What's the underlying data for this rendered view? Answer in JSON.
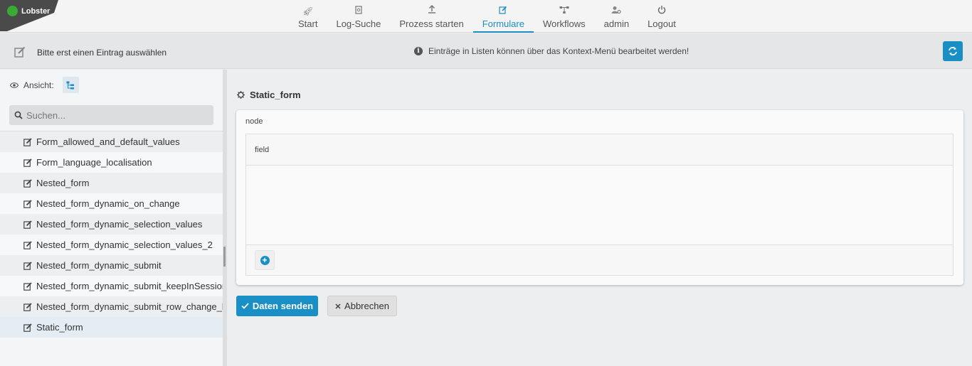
{
  "app": {
    "logo_text": "Lobster"
  },
  "nav": {
    "items": [
      {
        "label": "Start",
        "icon": "rocket-icon"
      },
      {
        "label": "Log-Suche",
        "icon": "file-search-icon"
      },
      {
        "label": "Prozess starten",
        "icon": "upload-icon"
      },
      {
        "label": "Formulare",
        "icon": "edit-icon",
        "active": true
      },
      {
        "label": "Workflows",
        "icon": "workflow-icon"
      },
      {
        "label": "admin",
        "icon": "user-gear-icon"
      },
      {
        "label": "Logout",
        "icon": "power-icon"
      }
    ]
  },
  "subbar": {
    "title": "Bitte erst einen Eintrag auswählen",
    "info": "Einträge in Listen können über das Kontext-Menü bearbeitet werden!"
  },
  "sidebar": {
    "view_label": "Ansicht:",
    "search_placeholder": "Suchen...",
    "items": [
      "Form_allowed_and_default_values",
      "Form_language_localisation",
      "Nested_form",
      "Nested_form_dynamic_on_change",
      "Nested_form_dynamic_selection_values",
      "Nested_form_dynamic_selection_values_2",
      "Nested_form_dynamic_submit",
      "Nested_form_dynamic_submit_keepInSession",
      "Nested_form_dynamic_submit_row_change_kind",
      "Static_form"
    ],
    "selected": "Static_form"
  },
  "main": {
    "form_title": "Static_form",
    "node_label": "node",
    "field_label": "field",
    "send_label": "Daten senden",
    "cancel_label": "Abbrechen"
  },
  "colors": {
    "accent": "#1a8fc5",
    "logo_bg": "#4a4a4a"
  }
}
